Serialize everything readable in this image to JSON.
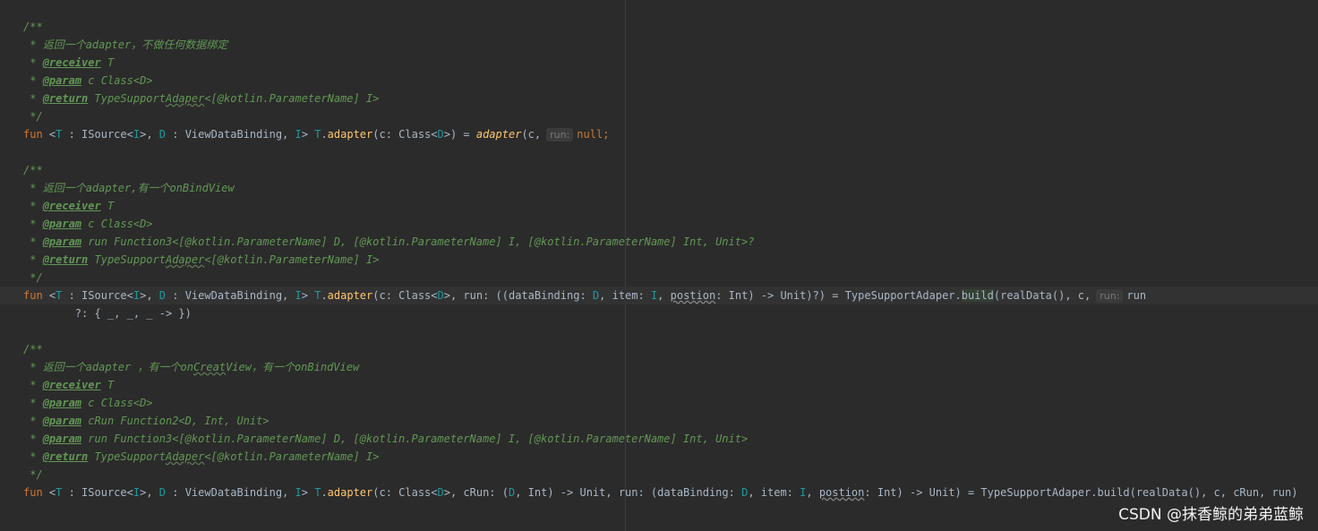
{
  "colors": {
    "background": "#2b2b2b",
    "default_text": "#a9b7c6",
    "keyword": "#cc7832",
    "doc_comment": "#629755",
    "type_param": "#20999d",
    "function": "#ffc66d",
    "inlay_hint": "#787878"
  },
  "editor": {
    "block1": {
      "open": "/**",
      "desc_prefix": " * ",
      "desc_text": "返回一个adapter，不做任何数据绑定",
      "receiver_prefix": " * ",
      "receiver_tag": "@receiver",
      "receiver_type": " T",
      "param_prefix": " * ",
      "param_tag": "@param",
      "param_name": " c",
      "param_type": " Class<D>",
      "return_prefix": " * ",
      "return_tag": "@return",
      "return_a": " TypeSupport",
      "return_b": "Adaper",
      "return_c": "<[@kotlin.ParameterName] I>",
      "close": " */",
      "code": {
        "fun": "fun",
        "lt": " <",
        "T": "T",
        "c1": " : ISource<",
        "I": "I",
        "c2": ">, ",
        "D": "D",
        "c3": " : ViewDataBinding, ",
        "I2": "I",
        "c4": "> ",
        "T2": "T",
        "dot": ".",
        "name": "adapter",
        "c5": "(c: Class<",
        "D2": "D",
        "c6": ">) = ",
        "call": "adapter",
        "c7": "(c,",
        "hint": "run:",
        "null": "null",
        "semi": ";"
      }
    },
    "block2": {
      "open": "/**",
      "desc_prefix": " * ",
      "desc_text": "返回一个adapter,有一个onBindView",
      "receiver_prefix": " * ",
      "receiver_tag": "@receiver",
      "receiver_type": " T",
      "param1_prefix": " * ",
      "param1_tag": "@param",
      "param1_name": " c",
      "param1_type": " Class<D>",
      "param2_prefix": " * ",
      "param2_tag": "@param",
      "param2_name": " run",
      "param2_type": " Function3<[@kotlin.ParameterName] D, [@kotlin.ParameterName] I, [@kotlin.ParameterName] Int, Unit>?",
      "return_prefix": " * ",
      "return_tag": "@return",
      "return_a": " TypeSupport",
      "return_b": "Adaper",
      "return_c": "<[@kotlin.ParameterName] I>",
      "close": " */",
      "code": {
        "fun": "fun",
        "lt": " <",
        "T": "T",
        "c1": " : ISource<",
        "I": "I",
        "c2": ">, ",
        "D": "D",
        "c3": " : ViewDataBinding, ",
        "I2": "I",
        "c4": "> ",
        "T2": "T",
        "dot": ".",
        "name": "adapter",
        "c5": "(c: Class<",
        "D2": "D",
        "c6": ">, run: ((dataBinding: ",
        "D3": "D",
        "c7": ", item: ",
        "I3": "I",
        "c8": ", ",
        "postion": "postion",
        "c9": ": Int) -> Unit)?) = TypeSupportAdaper.",
        "build": "build",
        "c10": "(realData(), c,",
        "hint": "run:",
        "c11": "run"
      },
      "cont": "        ?: { _, _, _ -> })"
    },
    "block3": {
      "open": "/**",
      "desc_prefix": " * ",
      "desc_a": "返回一个adapter ，有一个on",
      "desc_b": "Creat",
      "desc_c": "View，有一个onBindView",
      "receiver_prefix": " * ",
      "receiver_tag": "@receiver",
      "receiver_type": " T",
      "param1_prefix": " * ",
      "param1_tag": "@param",
      "param1_name": " c",
      "param1_type": " Class<D>",
      "param2_prefix": " * ",
      "param2_tag": "@param",
      "param2_name": " cRun",
      "param2_type": " Function2<D, Int, Unit>",
      "param3_prefix": " * ",
      "param3_tag": "@param",
      "param3_name": " run",
      "param3_type": " Function3<[@kotlin.ParameterName] D, [@kotlin.ParameterName] I, [@kotlin.ParameterName] Int, Unit>",
      "return_prefix": " * ",
      "return_tag": "@return",
      "return_a": " TypeSupport",
      "return_b": "Adaper",
      "return_c": "<[@kotlin.ParameterName] I>",
      "close": " */",
      "code": {
        "fun": "fun",
        "lt": " <",
        "T": "T",
        "c1": " : ISource<",
        "I": "I",
        "c2": ">, ",
        "D": "D",
        "c3": " : ViewDataBinding, ",
        "I2": "I",
        "c4": "> ",
        "T2": "T",
        "dot": ".",
        "name": "adapter",
        "c5": "(c: Class<",
        "D2": "D",
        "c6": ">, cRun: (",
        "D3": "D",
        "c7": ", Int) -> Unit, run: (dataBinding: ",
        "D4": "D",
        "c8": ", item: ",
        "I3": "I",
        "c9": ", ",
        "postion": "postion",
        "c10": ": Int) -> Unit) = TypeSupportAdaper.build(realData(), c, cRun, run)"
      }
    }
  },
  "watermark": "CSDN @抹香鲸的弟弟蓝鲸"
}
